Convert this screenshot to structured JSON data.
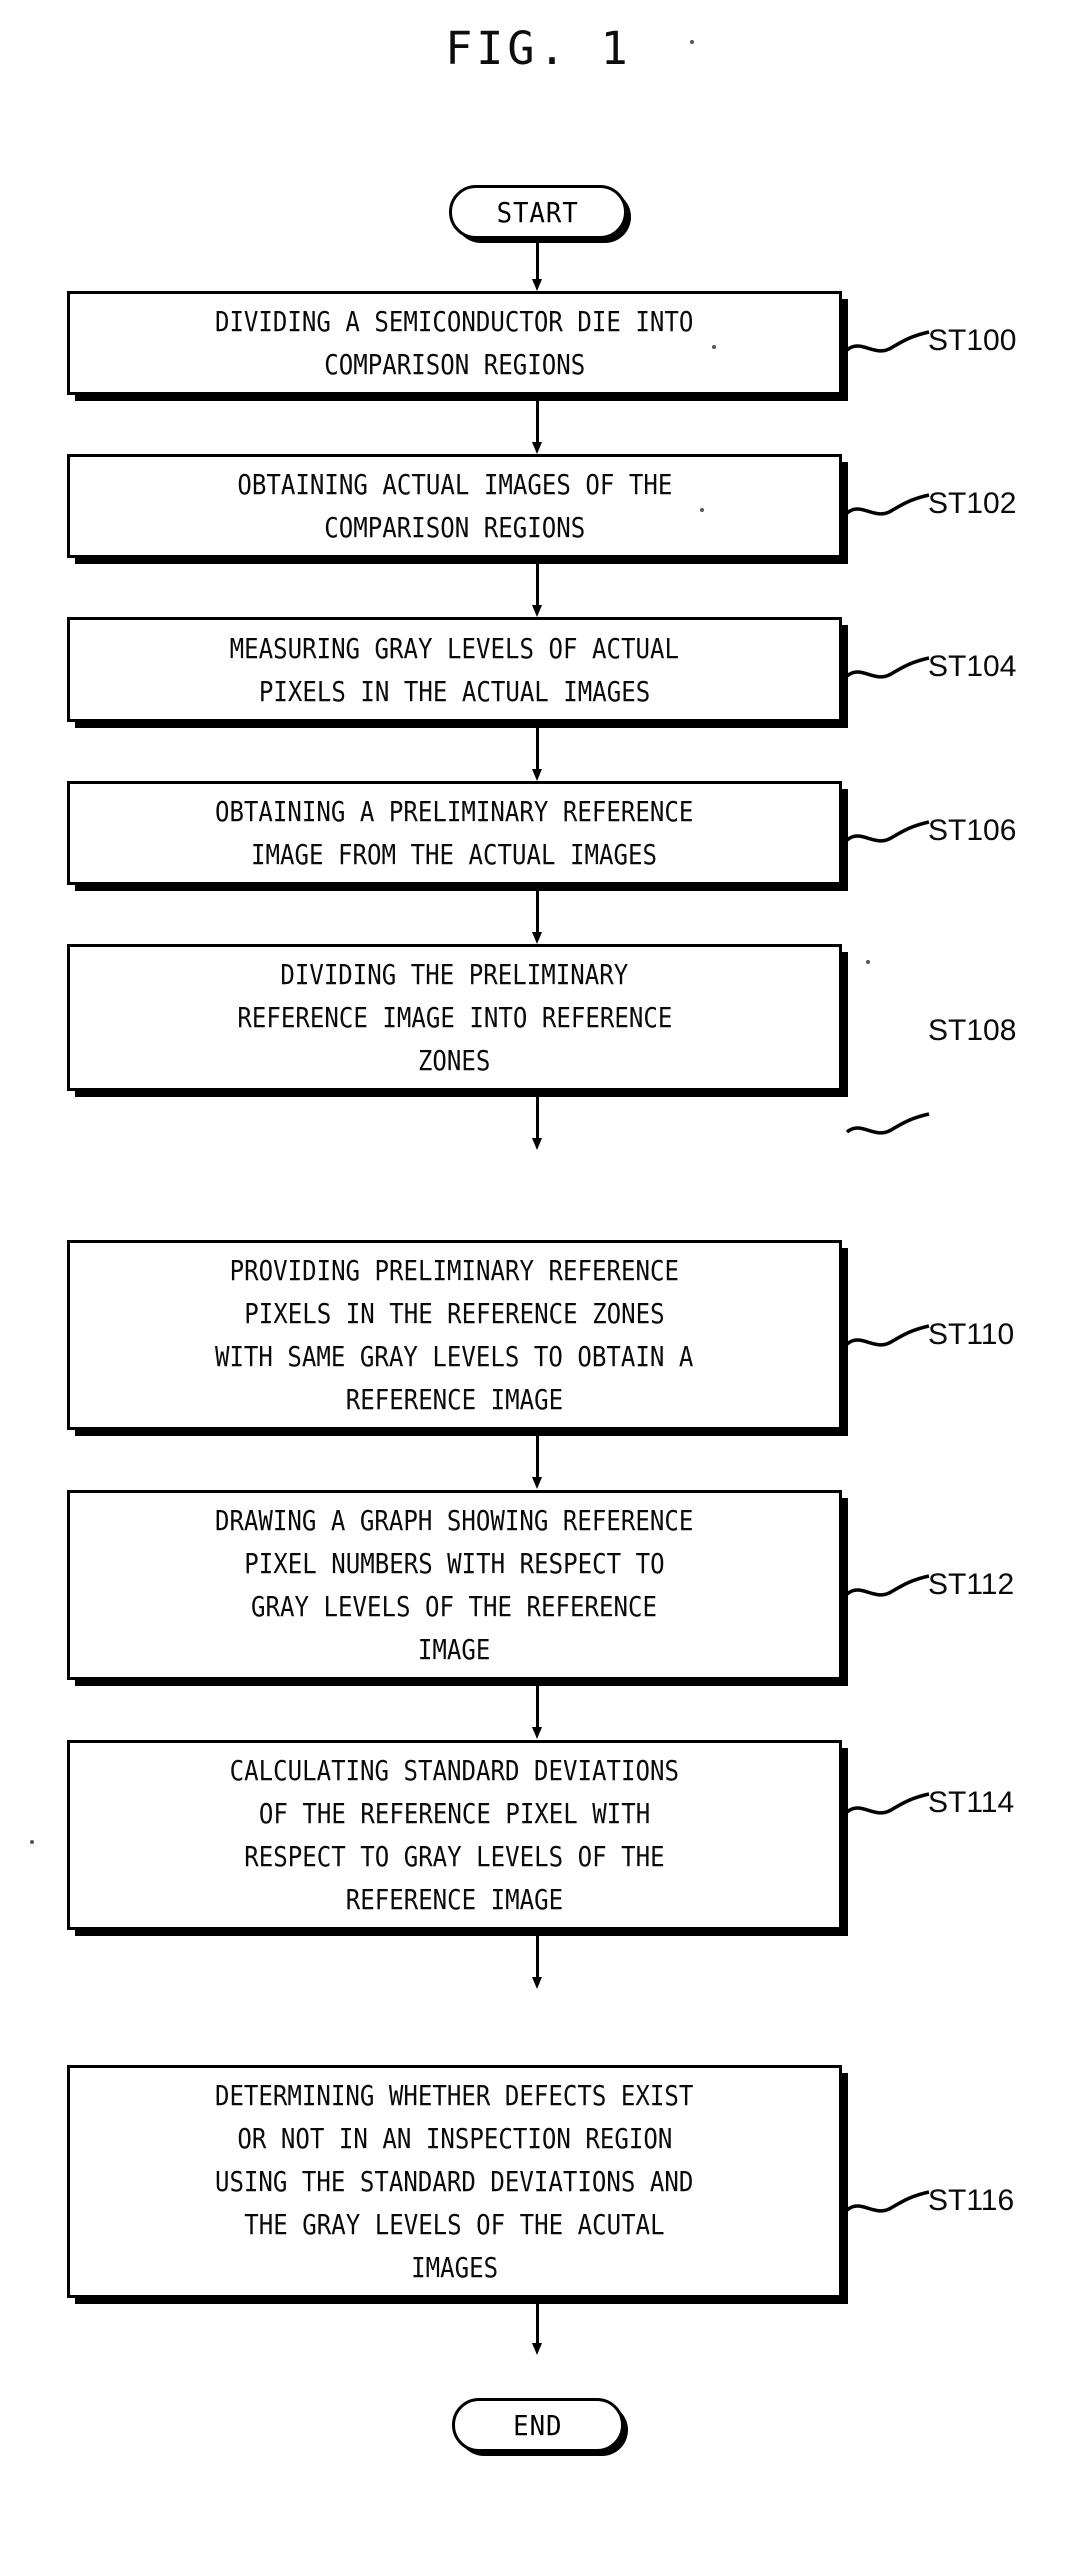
{
  "figure": {
    "title": "FIG. 1"
  },
  "flowchart": {
    "type": "flowchart",
    "orientation": "top-to-bottom",
    "start_label": "START",
    "end_label": "END",
    "steps": [
      {
        "ref": "ST100",
        "lines": [
          "DIVIDING A SEMICONDUCTOR DIE INTO",
          "COMPARISON REGIONS"
        ]
      },
      {
        "ref": "ST102",
        "lines": [
          "OBTAINING ACTUAL IMAGES OF THE",
          "COMPARISON REGIONS"
        ]
      },
      {
        "ref": "ST104",
        "lines": [
          "MEASURING GRAY LEVELS OF ACTUAL",
          "PIXELS IN THE ACTUAL IMAGES"
        ]
      },
      {
        "ref": "ST106",
        "lines": [
          "OBTAINING A PRELIMINARY REFERENCE",
          "IMAGE FROM THE ACTUAL IMAGES"
        ]
      },
      {
        "ref": "ST108",
        "lines": [
          "DIVIDING THE PRELIMINARY",
          "REFERENCE IMAGE INTO REFERENCE",
          "ZONES"
        ]
      },
      {
        "ref": "ST110",
        "lines": [
          "PROVIDING PRELIMINARY REFERENCE",
          "PIXELS IN THE REFERENCE ZONES",
          "WITH SAME GRAY LEVELS TO OBTAIN A",
          "REFERENCE IMAGE"
        ]
      },
      {
        "ref": "ST112",
        "lines": [
          "DRAWING A GRAPH SHOWING REFERENCE",
          "PIXEL NUMBERS WITH RESPECT TO",
          "GRAY LEVELS OF THE REFERENCE",
          "IMAGE"
        ]
      },
      {
        "ref": "ST114",
        "lines": [
          "CALCULATING STANDARD DEVIATIONS",
          "OF THE REFERENCE PIXEL WITH",
          "RESPECT TO GRAY LEVELS OF THE",
          "REFERENCE IMAGE"
        ]
      },
      {
        "ref": "ST116",
        "lines": [
          "DETERMINING WHETHER DEFECTS EXIST",
          "OR NOT IN AN INSPECTION REGION",
          "USING THE STANDARD DEVIATIONS AND",
          "THE GRAY LEVELS OF THE ACUTAL",
          "IMAGES"
        ]
      }
    ]
  }
}
